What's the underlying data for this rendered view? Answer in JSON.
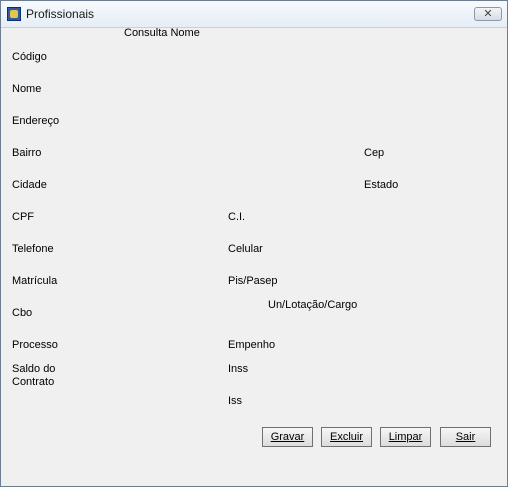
{
  "window": {
    "title": "Profissionais",
    "close_glyph": "✕"
  },
  "form": {
    "consulta_nome": "Consulta Nome",
    "codigo": "Código",
    "nome": "Nome",
    "endereco": "Endereço",
    "bairro": "Bairro",
    "cep": "Cep",
    "cidade": "Cidade",
    "estado": "Estado",
    "cpf": "CPF",
    "ci": "C.I.",
    "telefone": "Telefone",
    "celular": "Celular",
    "matricula": "Matrícula",
    "pis_pasep": "Pis/Pasep",
    "lotacao": "Un/Lotação/Cargo",
    "cbo": "Cbo",
    "processo": "Processo",
    "empenho": "Empenho",
    "saldo_contrato": "Saldo do Contrato",
    "inss": "Inss",
    "iss": "Iss"
  },
  "buttons": {
    "gravar": "Gravar",
    "excluir": "Excluir",
    "limpar": "Limpar",
    "sair": "Sair"
  },
  "icons": {
    "app": "app-icon",
    "close": "close-icon"
  }
}
